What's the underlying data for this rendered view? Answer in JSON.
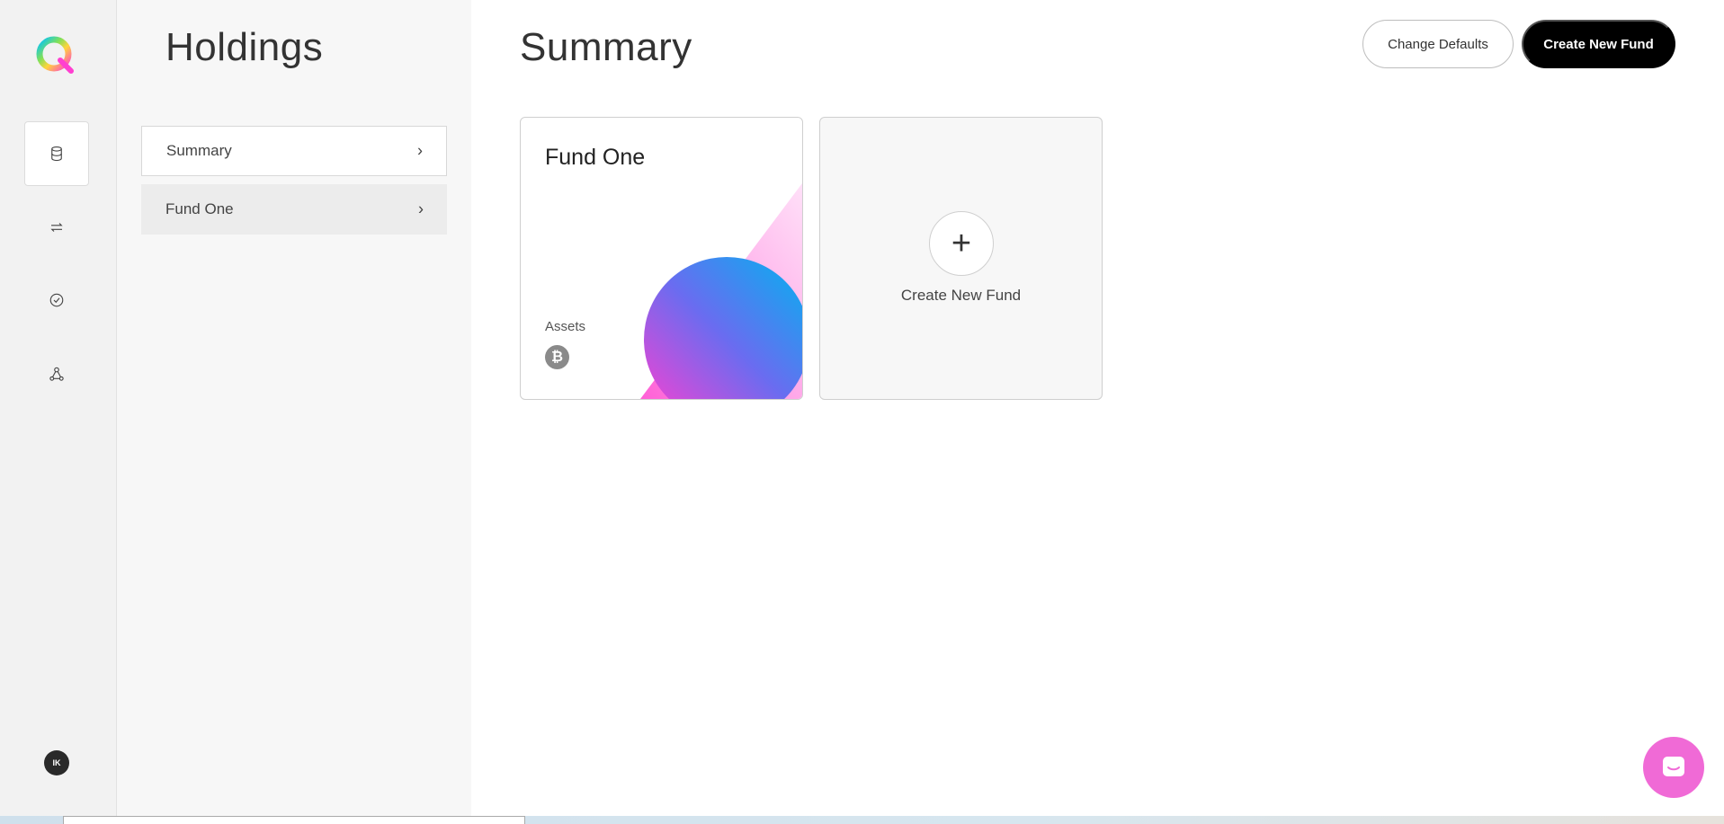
{
  "rail": {
    "items": [
      {
        "icon": "database-icon",
        "active": true
      },
      {
        "icon": "transfer-arrows-icon",
        "active": false
      },
      {
        "icon": "check-circle-icon",
        "active": false
      },
      {
        "icon": "network-icon",
        "active": false
      }
    ],
    "avatar_initials": "IK"
  },
  "sidebar": {
    "title": "Holdings",
    "items": [
      {
        "label": "Summary"
      },
      {
        "label": "Fund One"
      }
    ]
  },
  "main": {
    "title": "Summary",
    "change_defaults_label": "Change Defaults",
    "create_new_fund_label": "Create New Fund",
    "fund_card": {
      "name": "Fund One",
      "assets_label": "Assets",
      "asset_icon": "bitcoin-icon",
      "asset_symbol": "₿"
    },
    "new_fund_card": {
      "plus": "+",
      "label": "Create New Fund"
    }
  },
  "colors": {
    "accent_pink": "#f06ad6",
    "primary_button": "#000000"
  }
}
